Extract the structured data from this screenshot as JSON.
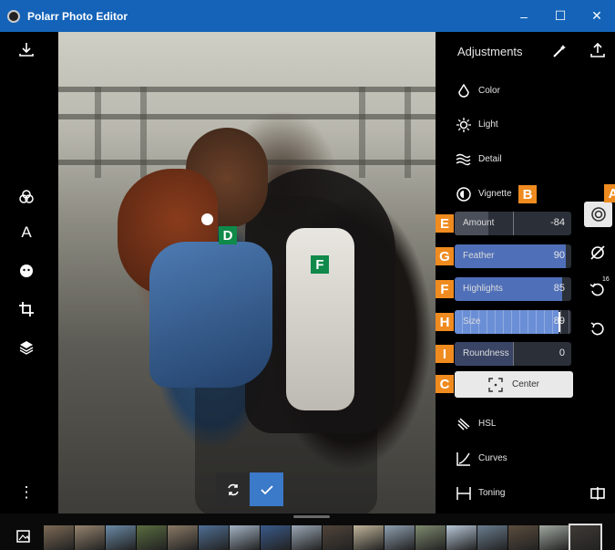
{
  "window": {
    "title": "Polarr Photo Editor",
    "minimize": "–",
    "maximize": "☐",
    "close": "✕"
  },
  "left_rail": {
    "items": [
      "download-icon",
      "color-filter-icon",
      "text-icon",
      "face-icon",
      "crop-icon",
      "layers-icon",
      "more-icon"
    ],
    "text_tool": "A",
    "more": "⋮"
  },
  "canvas": {
    "badges": {
      "D": "D",
      "F": "F"
    }
  },
  "confirm": {
    "reset": "reset-icon",
    "apply": "check-icon"
  },
  "adjustments": {
    "title": "Adjustments",
    "menu": [
      {
        "label": "Color",
        "icon": "color-drop-icon"
      },
      {
        "label": "Light",
        "icon": "sun-icon"
      },
      {
        "label": "Detail",
        "icon": "waves-icon"
      },
      {
        "label": "Vignette",
        "icon": "vignette-icon"
      }
    ],
    "vignette_badge": "B",
    "sliders": [
      {
        "label": "Amount",
        "value": "-84",
        "fraction": 0.29,
        "badge": "E",
        "color": "#4a4f5a"
      },
      {
        "label": "Feather",
        "value": "90",
        "fraction": 0.95,
        "badge": "G",
        "color": "#4f6fb8"
      },
      {
        "label": "Highlights",
        "value": "85",
        "fraction": 0.92,
        "badge": "F",
        "color": "#4f6fb8"
      },
      {
        "label": "Size",
        "value": "89",
        "fraction": 0.89,
        "badge": "H",
        "color": "#6b8fd6",
        "active": true
      },
      {
        "label": "Roundness",
        "value": "0",
        "fraction": 0.5,
        "badge": "I",
        "color": "#3a4566"
      }
    ],
    "center": {
      "label": "Center",
      "badge": "C"
    },
    "menu_bottom": [
      {
        "label": "HSL",
        "icon": "hsl-icon"
      },
      {
        "label": "Curves",
        "icon": "curves-icon"
      },
      {
        "label": "Toning",
        "icon": "toning-icon"
      }
    ]
  },
  "right_rail": {
    "active_badge": "A",
    "history_count": "16"
  },
  "filmstrip": {
    "thumbnails": [
      "#7d6a55",
      "#96846e",
      "#6a8aa5",
      "#5a6d3f",
      "#8a7a66",
      "#4f6f94",
      "#a3b3c4",
      "#3a5a8a",
      "#9aa7b5",
      "#50443a",
      "#c0b49a",
      "#8fa0b0",
      "#7e8a6f",
      "#b8c8d8",
      "#6a7d8f",
      "#5b4d3e",
      "#a0a8a0",
      "#3f3a35"
    ]
  }
}
